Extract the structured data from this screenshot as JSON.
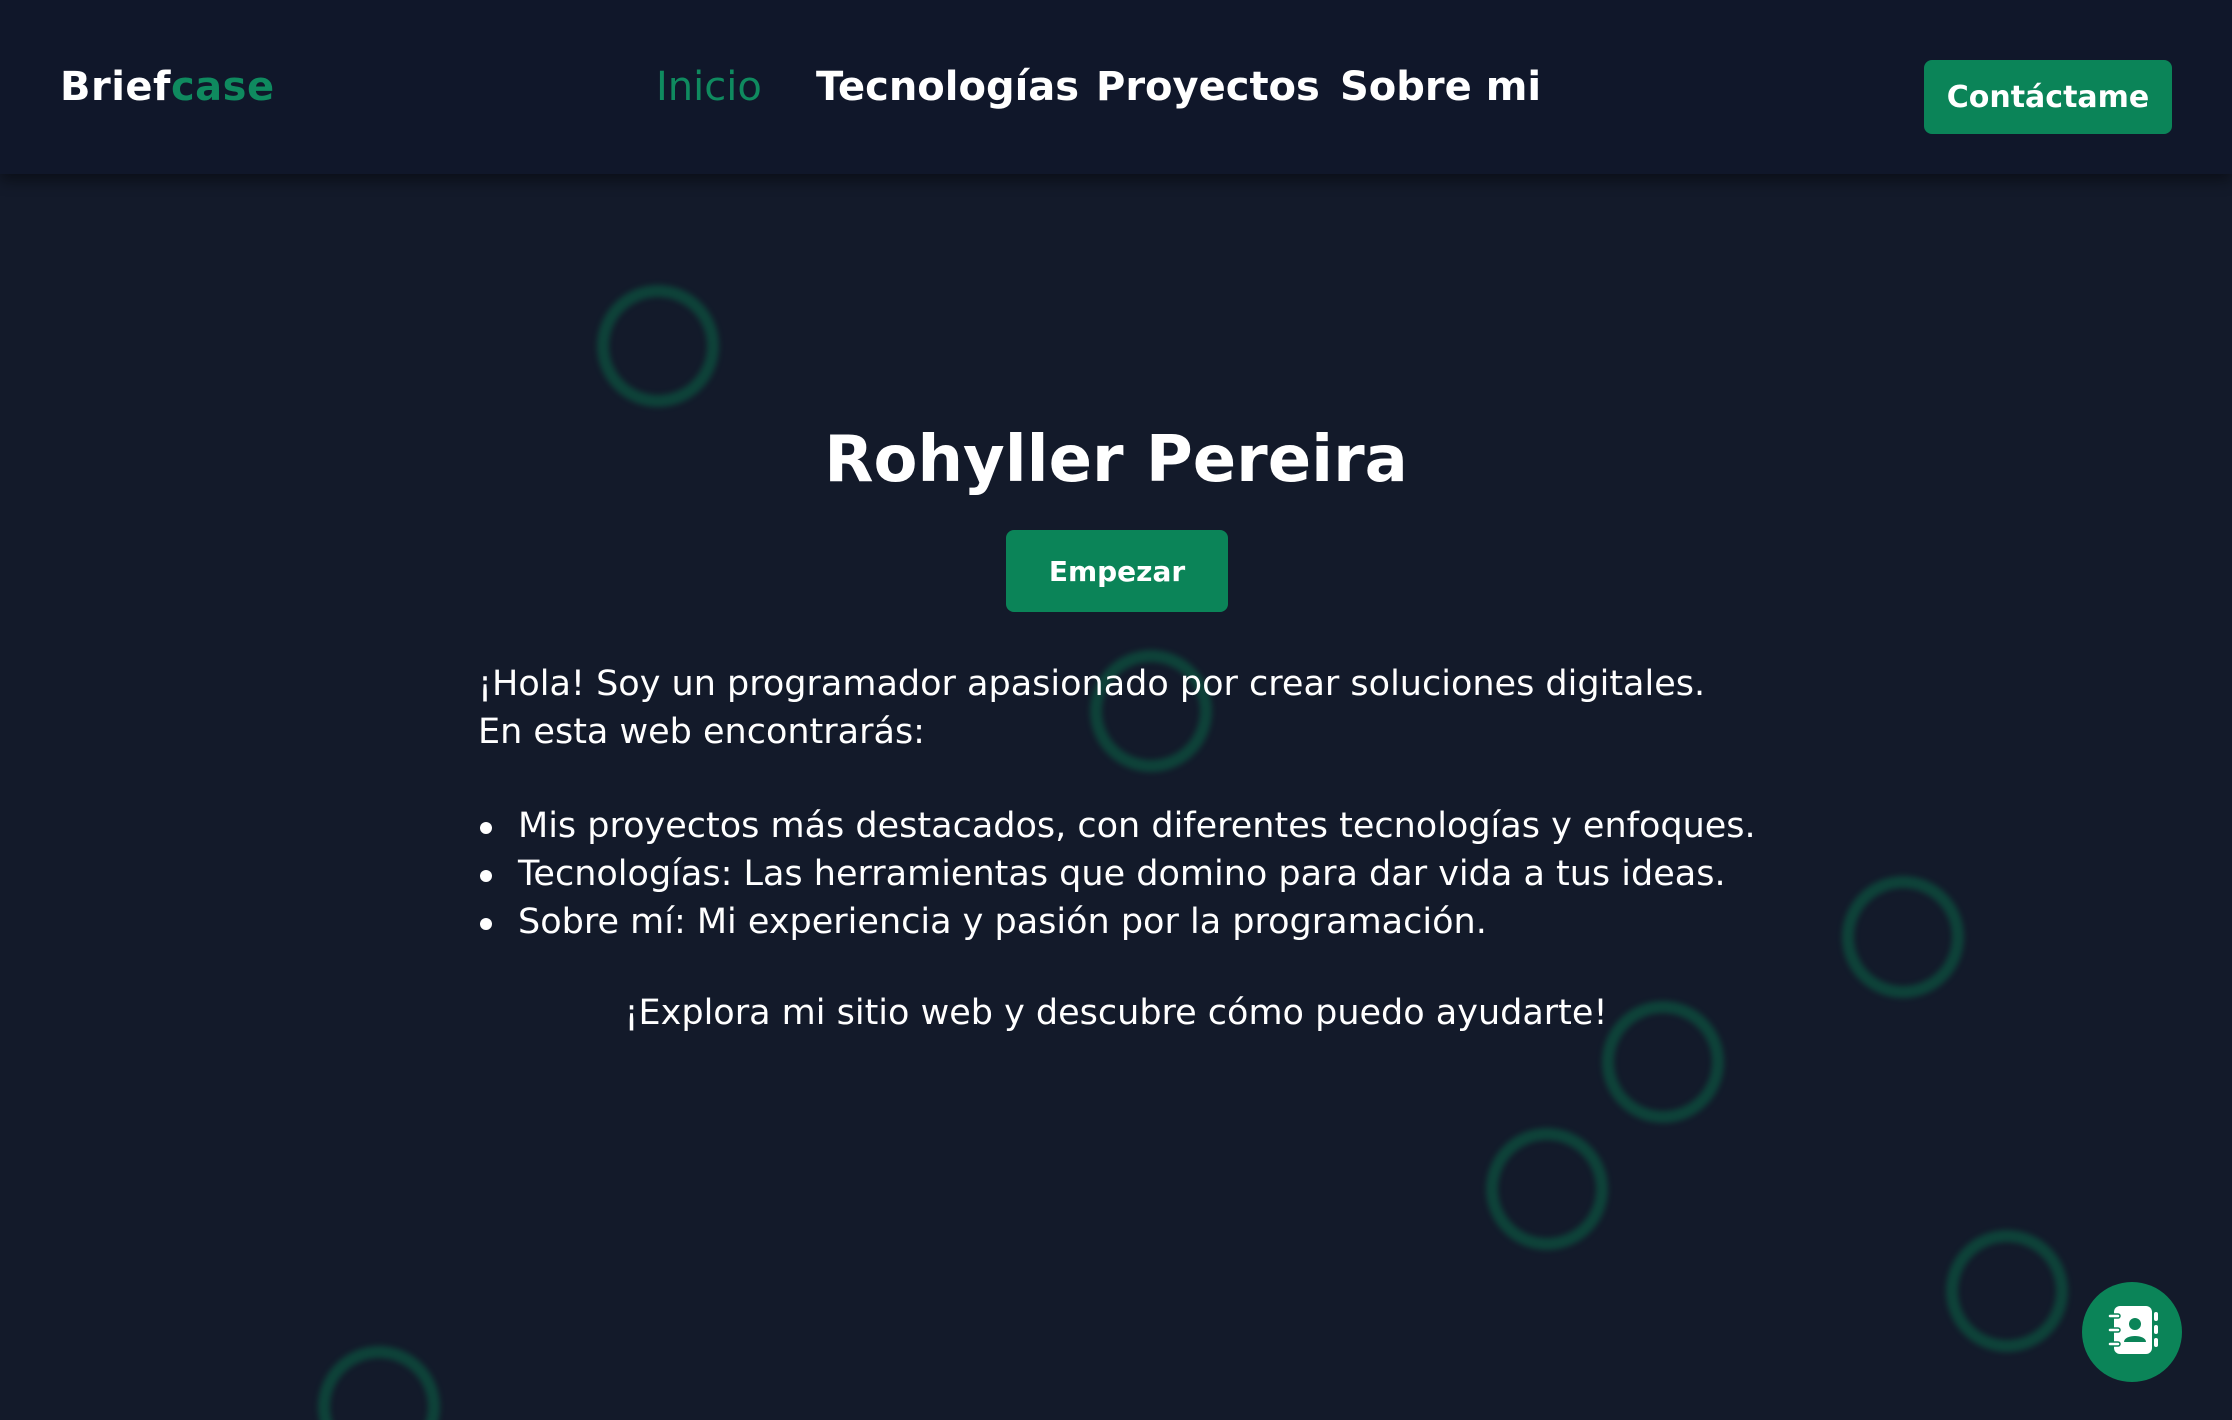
{
  "header": {
    "logo": {
      "part1": "Brief",
      "part2": "case"
    },
    "nav": [
      {
        "label": "Inicio",
        "active": true
      },
      {
        "label": "Tecnologías",
        "active": false
      },
      {
        "label": "Proyectos",
        "active": false
      },
      {
        "label": "Sobre mi",
        "active": false
      }
    ],
    "contact_button": "Contáctame"
  },
  "hero": {
    "title": "Rohyller Pereira",
    "start_button": "Empezar",
    "intro_line1": "¡Hola! Soy un programador apasionado por crear soluciones digitales.",
    "intro_line2": "En esta web encontrarás:",
    "bullets": [
      "Mis proyectos más destacados, con diferentes tecnologías y enfoques.",
      "Tecnologías: Las herramientas que domino para dar vida a tus ideas.",
      "Sobre mí: Mi experiencia y pasión por la programación."
    ],
    "closing": "¡Explora mi sitio web y descubre cómo puedo ayudarte!"
  },
  "fab": {
    "icon": "contact-book-icon"
  },
  "colors": {
    "background": "#131a2a",
    "header": "#10172a",
    "accent": "#0b8458",
    "accent_text": "#0f8a5f",
    "ring": "#0d4a3c",
    "text": "#ffffff"
  }
}
